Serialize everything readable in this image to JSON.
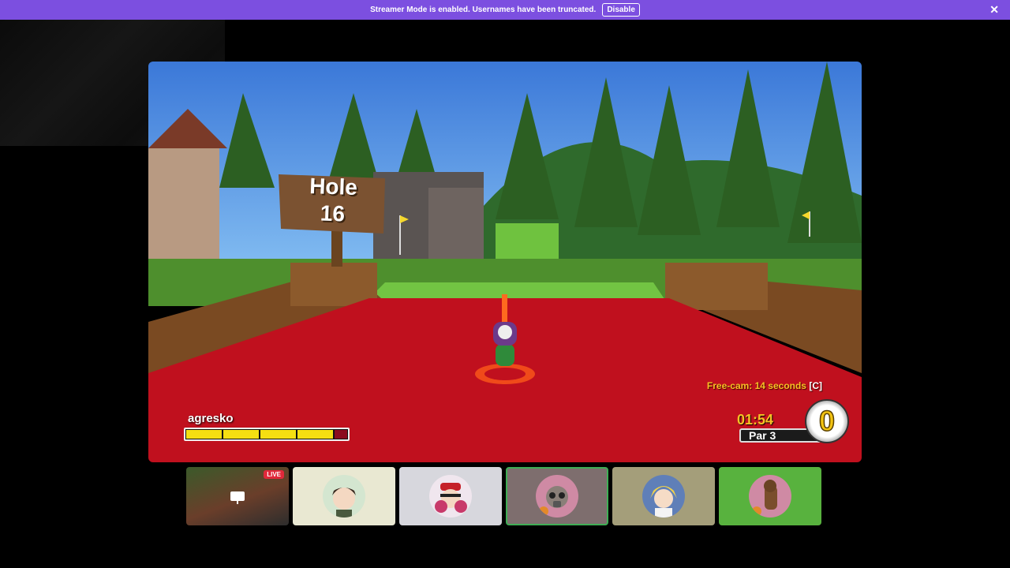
{
  "banner": {
    "message": "Streamer Mode is enabled. Usernames have been truncated.",
    "disable_label": "Disable",
    "close_icon": "close-icon",
    "color": "#7c4fe0"
  },
  "game": {
    "sign_title": "Hole",
    "sign_number": "16",
    "player_name": "agresko",
    "power_level_fraction": 0.93,
    "freecam_text": "Free-cam: 14 seconds",
    "freecam_key": "[C]",
    "timer": "01:54",
    "par": "Par 3",
    "strokes": "0"
  },
  "participants": {
    "live_badge": "LIVE",
    "tiles": [
      {
        "kind": "stream",
        "icon": "monitor-icon"
      },
      {
        "kind": "avatar",
        "bg": "#e9e8d2",
        "avatar": "dark-haired-boy"
      },
      {
        "kind": "avatar",
        "bg": "#d7d7dd",
        "avatar": "cap-character"
      },
      {
        "kind": "avatar",
        "bg": "#7e6e6e",
        "avatar": "gasmask-character",
        "active": true
      },
      {
        "kind": "avatar",
        "bg": "#a49e7a",
        "avatar": "blonde-anime"
      },
      {
        "kind": "avatar",
        "bg": "#58b23e",
        "avatar": "brown-creature"
      }
    ]
  }
}
